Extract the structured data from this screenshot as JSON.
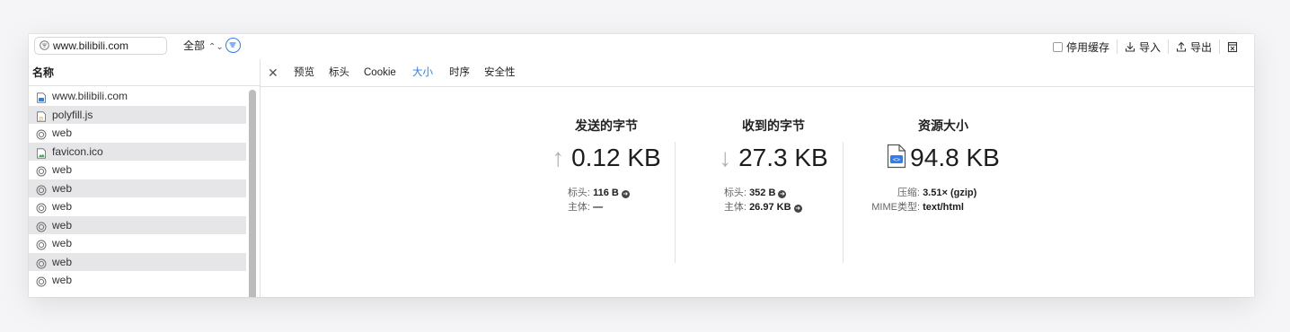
{
  "toolbar": {
    "search_value": "www.bilibili.com",
    "filter_value": "全部",
    "filter_chevron": "⌃",
    "disable_cache_label": "停用缓存",
    "import_label": "导入",
    "export_label": "导出"
  },
  "left": {
    "header": "名称",
    "rows": [
      {
        "name": "www.bilibili.com",
        "icon": "html-doc-icon"
      },
      {
        "name": "polyfill.js",
        "icon": "js-file-icon"
      },
      {
        "name": "web",
        "icon": "circle-icon"
      },
      {
        "name": "favicon.ico",
        "icon": "image-file-icon"
      },
      {
        "name": "web",
        "icon": "circle-icon"
      },
      {
        "name": "web",
        "icon": "circle-icon"
      },
      {
        "name": "web",
        "icon": "circle-icon"
      },
      {
        "name": "web",
        "icon": "circle-icon"
      },
      {
        "name": "web",
        "icon": "circle-icon"
      },
      {
        "name": "web",
        "icon": "circle-icon"
      },
      {
        "name": "web",
        "icon": "circle-icon"
      }
    ]
  },
  "tabs": {
    "close": "✕",
    "preview": "预览",
    "headers": "标头",
    "cookie": "Cookie",
    "size": "大小",
    "timing": "时序",
    "security": "安全性",
    "active": "size"
  },
  "sent": {
    "title": "发送的字节",
    "arrow": "↑",
    "value": "0.12 KB",
    "headers_label": "标头:",
    "headers_value": "116 B",
    "body_label": "主体:",
    "body_value": "—"
  },
  "received": {
    "title": "收到的字节",
    "arrow": "↓",
    "value": "27.3 KB",
    "headers_label": "标头:",
    "headers_value": "352 B",
    "body_label": "主体:",
    "body_value": "26.97 KB"
  },
  "resource": {
    "title": "资源大小",
    "value": "94.8 KB",
    "compression_label": "压缩:",
    "compression_value": "3.51× (gzip)",
    "mime_label": "MIME类型:",
    "mime_value": "text/html"
  },
  "colors": {
    "accent": "#2f7df6",
    "row_alt": "#e6e6e9"
  }
}
